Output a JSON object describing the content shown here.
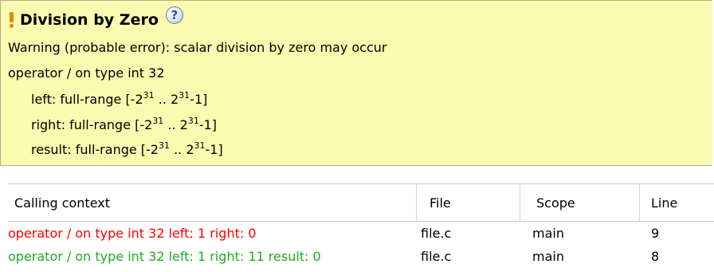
{
  "tooltip": {
    "title": "Division by Zero",
    "help_glyph": "?",
    "warning": "Warning (probable error): scalar division by zero may occur",
    "operator_line": "operator / on type int 32",
    "left_prefix": "left:   full-range [-2",
    "right_prefix": "right:  full-range [-2",
    "result_prefix": "result: full-range [-2",
    "exp": "31",
    "mid": " .. 2",
    "suffix": "-1]",
    "colors": {
      "background": "#fafab0",
      "warning_icon": "#e08a00"
    }
  },
  "table": {
    "columns": [
      "Calling context",
      "File",
      "Scope",
      "Line"
    ],
    "rows": [
      {
        "context": "operator / on type int 32  left: 1  right: 0",
        "file": "file.c",
        "scope": "main",
        "line": "9",
        "color": "#ff0000"
      },
      {
        "context": "operator / on type int 32  left: 1  right: 11  result: 0",
        "file": "file.c",
        "scope": "main",
        "line": "8",
        "color": "#22aa22"
      }
    ]
  }
}
